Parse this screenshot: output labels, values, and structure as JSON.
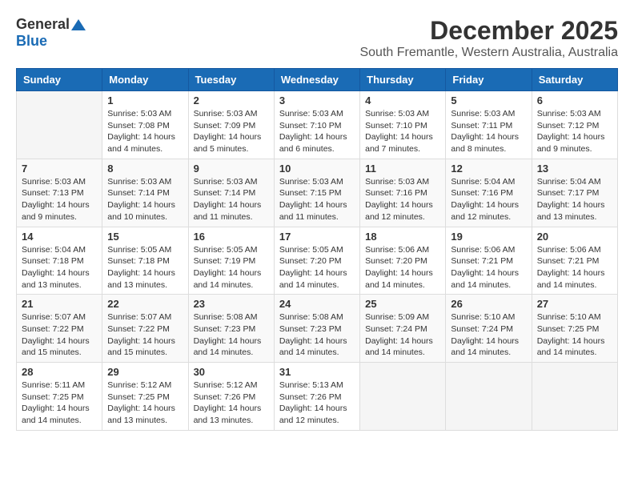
{
  "logo": {
    "general": "General",
    "blue": "Blue"
  },
  "title": "December 2025",
  "location": "South Fremantle, Western Australia, Australia",
  "weekdays": [
    "Sunday",
    "Monday",
    "Tuesday",
    "Wednesday",
    "Thursday",
    "Friday",
    "Saturday"
  ],
  "weeks": [
    [
      {
        "day": "",
        "info": ""
      },
      {
        "day": "1",
        "info": "Sunrise: 5:03 AM\nSunset: 7:08 PM\nDaylight: 14 hours\nand 4 minutes."
      },
      {
        "day": "2",
        "info": "Sunrise: 5:03 AM\nSunset: 7:09 PM\nDaylight: 14 hours\nand 5 minutes."
      },
      {
        "day": "3",
        "info": "Sunrise: 5:03 AM\nSunset: 7:10 PM\nDaylight: 14 hours\nand 6 minutes."
      },
      {
        "day": "4",
        "info": "Sunrise: 5:03 AM\nSunset: 7:10 PM\nDaylight: 14 hours\nand 7 minutes."
      },
      {
        "day": "5",
        "info": "Sunrise: 5:03 AM\nSunset: 7:11 PM\nDaylight: 14 hours\nand 8 minutes."
      },
      {
        "day": "6",
        "info": "Sunrise: 5:03 AM\nSunset: 7:12 PM\nDaylight: 14 hours\nand 9 minutes."
      }
    ],
    [
      {
        "day": "7",
        "info": "Sunrise: 5:03 AM\nSunset: 7:13 PM\nDaylight: 14 hours\nand 9 minutes."
      },
      {
        "day": "8",
        "info": "Sunrise: 5:03 AM\nSunset: 7:14 PM\nDaylight: 14 hours\nand 10 minutes."
      },
      {
        "day": "9",
        "info": "Sunrise: 5:03 AM\nSunset: 7:14 PM\nDaylight: 14 hours\nand 11 minutes."
      },
      {
        "day": "10",
        "info": "Sunrise: 5:03 AM\nSunset: 7:15 PM\nDaylight: 14 hours\nand 11 minutes."
      },
      {
        "day": "11",
        "info": "Sunrise: 5:03 AM\nSunset: 7:16 PM\nDaylight: 14 hours\nand 12 minutes."
      },
      {
        "day": "12",
        "info": "Sunrise: 5:04 AM\nSunset: 7:16 PM\nDaylight: 14 hours\nand 12 minutes."
      },
      {
        "day": "13",
        "info": "Sunrise: 5:04 AM\nSunset: 7:17 PM\nDaylight: 14 hours\nand 13 minutes."
      }
    ],
    [
      {
        "day": "14",
        "info": "Sunrise: 5:04 AM\nSunset: 7:18 PM\nDaylight: 14 hours\nand 13 minutes."
      },
      {
        "day": "15",
        "info": "Sunrise: 5:05 AM\nSunset: 7:18 PM\nDaylight: 14 hours\nand 13 minutes."
      },
      {
        "day": "16",
        "info": "Sunrise: 5:05 AM\nSunset: 7:19 PM\nDaylight: 14 hours\nand 14 minutes."
      },
      {
        "day": "17",
        "info": "Sunrise: 5:05 AM\nSunset: 7:20 PM\nDaylight: 14 hours\nand 14 minutes."
      },
      {
        "day": "18",
        "info": "Sunrise: 5:06 AM\nSunset: 7:20 PM\nDaylight: 14 hours\nand 14 minutes."
      },
      {
        "day": "19",
        "info": "Sunrise: 5:06 AM\nSunset: 7:21 PM\nDaylight: 14 hours\nand 14 minutes."
      },
      {
        "day": "20",
        "info": "Sunrise: 5:06 AM\nSunset: 7:21 PM\nDaylight: 14 hours\nand 14 minutes."
      }
    ],
    [
      {
        "day": "21",
        "info": "Sunrise: 5:07 AM\nSunset: 7:22 PM\nDaylight: 14 hours\nand 15 minutes."
      },
      {
        "day": "22",
        "info": "Sunrise: 5:07 AM\nSunset: 7:22 PM\nDaylight: 14 hours\nand 15 minutes."
      },
      {
        "day": "23",
        "info": "Sunrise: 5:08 AM\nSunset: 7:23 PM\nDaylight: 14 hours\nand 14 minutes."
      },
      {
        "day": "24",
        "info": "Sunrise: 5:08 AM\nSunset: 7:23 PM\nDaylight: 14 hours\nand 14 minutes."
      },
      {
        "day": "25",
        "info": "Sunrise: 5:09 AM\nSunset: 7:24 PM\nDaylight: 14 hours\nand 14 minutes."
      },
      {
        "day": "26",
        "info": "Sunrise: 5:10 AM\nSunset: 7:24 PM\nDaylight: 14 hours\nand 14 minutes."
      },
      {
        "day": "27",
        "info": "Sunrise: 5:10 AM\nSunset: 7:25 PM\nDaylight: 14 hours\nand 14 minutes."
      }
    ],
    [
      {
        "day": "28",
        "info": "Sunrise: 5:11 AM\nSunset: 7:25 PM\nDaylight: 14 hours\nand 14 minutes."
      },
      {
        "day": "29",
        "info": "Sunrise: 5:12 AM\nSunset: 7:25 PM\nDaylight: 14 hours\nand 13 minutes."
      },
      {
        "day": "30",
        "info": "Sunrise: 5:12 AM\nSunset: 7:26 PM\nDaylight: 14 hours\nand 13 minutes."
      },
      {
        "day": "31",
        "info": "Sunrise: 5:13 AM\nSunset: 7:26 PM\nDaylight: 14 hours\nand 12 minutes."
      },
      {
        "day": "",
        "info": ""
      },
      {
        "day": "",
        "info": ""
      },
      {
        "day": "",
        "info": ""
      }
    ]
  ]
}
